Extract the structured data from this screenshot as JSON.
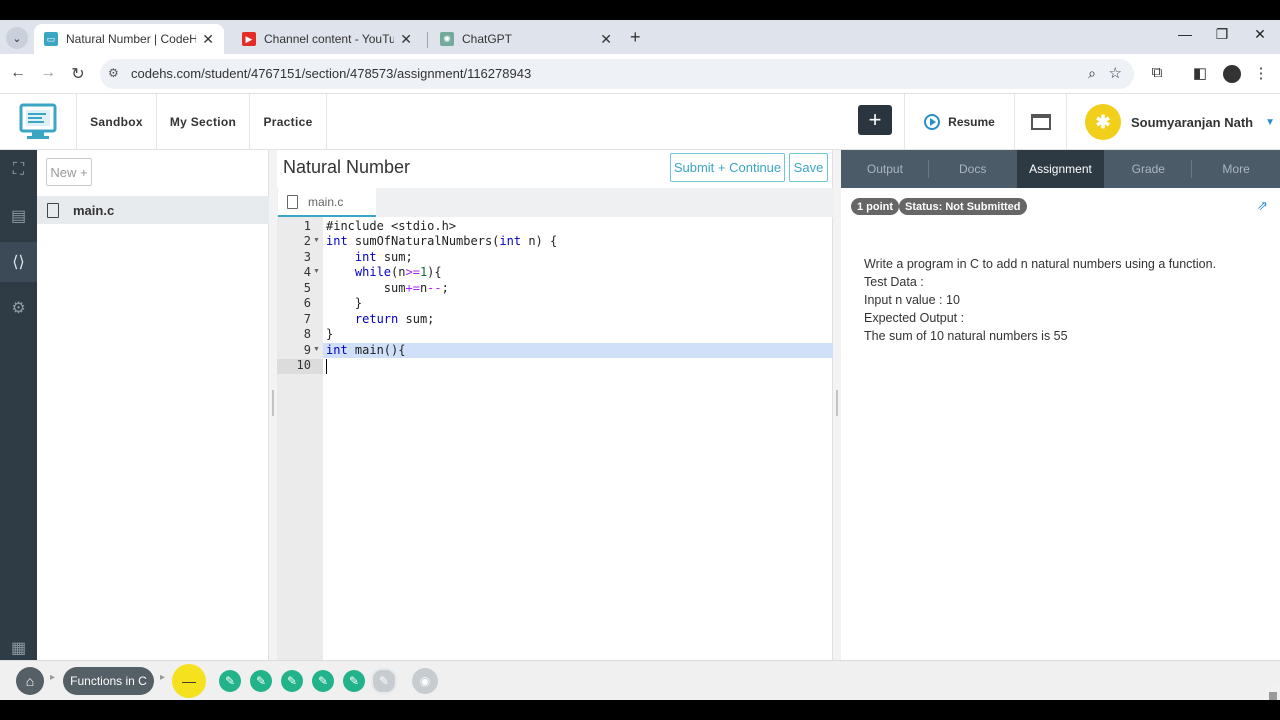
{
  "browser": {
    "tabs": [
      {
        "title": "Natural Number | CodeHS",
        "favicon": "codehs-icon",
        "active": true
      },
      {
        "title": "Channel content - YouTube Stu",
        "favicon": "youtube-icon",
        "active": false
      },
      {
        "title": "ChatGPT",
        "favicon": "chatgpt-icon",
        "active": false
      }
    ],
    "url": "codehs.com/student/4767151/section/478573/assignment/116278943"
  },
  "header": {
    "nav": [
      "Sandbox",
      "My Section",
      "Practice"
    ],
    "resume_label": "Resume",
    "user_name": "Soumyaranjan Nath"
  },
  "files": {
    "new_label": "New +",
    "items": [
      "main.c"
    ]
  },
  "editor": {
    "title": "Natural Number",
    "submit_label": "Submit + Continue",
    "save_label": "Save",
    "active_file": "main.c",
    "line_numbers": [
      "1",
      "2",
      "3",
      "4",
      "5",
      "6",
      "7",
      "8",
      "9",
      "10"
    ]
  },
  "panel": {
    "tabs": [
      "Output",
      "Docs",
      "Assignment",
      "Grade",
      "More"
    ],
    "active_tab": "Assignment",
    "points": "1 point",
    "status": "Status: Not Submitted",
    "description": [
      "Write a program in C to add n natural numbers using a function.",
      "Test Data :",
      "Input n value : 10",
      "Expected Output :",
      "The sum of 10 natural numbers is 55"
    ]
  },
  "bottom": {
    "crumb": "Functions in C",
    "current_symbol": "—"
  },
  "colors": {
    "accent": "#3ba6c4",
    "rail_bg": "#2f3b45",
    "task_done": "#22b38a",
    "current": "#f5e11e"
  }
}
